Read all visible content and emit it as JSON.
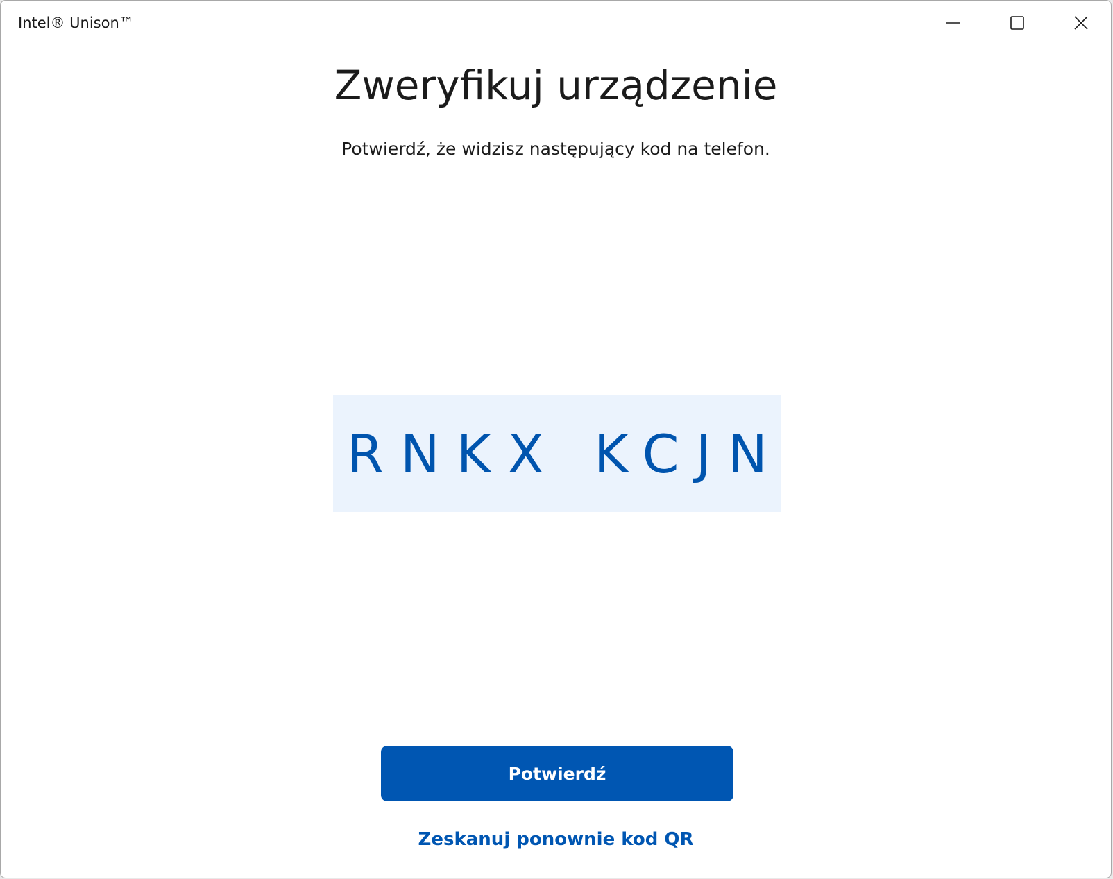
{
  "window": {
    "title": "Intel® Unison™",
    "controls": {
      "minimize_icon": "minimize-icon",
      "maximize_icon": "maximize-icon",
      "close_icon": "close-icon"
    }
  },
  "main": {
    "heading": "Zweryfikuj urządzenie",
    "instruction": "Potwierdź, że widzisz następujący kod na telefon.",
    "verification_code": "RNKX KCJN",
    "confirm_label": "Potwierdź",
    "rescan_label": "Zeskanuj ponownie kod QR"
  },
  "colors": {
    "accent": "#0056b2",
    "code_text": "#0054ae",
    "code_background": "#ebf3fd",
    "text": "#1b1b1b",
    "window_background": "#ffffff"
  }
}
